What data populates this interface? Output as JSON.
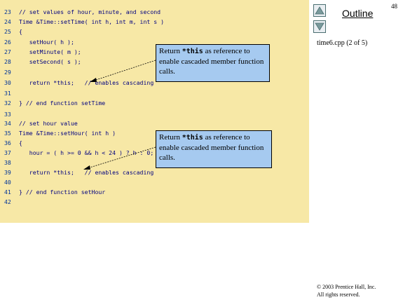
{
  "outline": {
    "title": "Outline",
    "page_number": "48",
    "file_label": "time6.cpp (2 of 5)"
  },
  "code_lines": [
    {
      "num": "23",
      "text": "// set values of hour, minute, and second"
    },
    {
      "num": "24",
      "text": "Time &Time::setTime( int h, int m, int s )"
    },
    {
      "num": "25",
      "text": "{"
    },
    {
      "num": "26",
      "text": "   setHour( h );"
    },
    {
      "num": "27",
      "text": "   setMinute( m );"
    },
    {
      "num": "28",
      "text": "   setSecond( s );"
    },
    {
      "num": "29",
      "text": ""
    },
    {
      "num": "30",
      "text": "   return *this;   // enables cascading"
    },
    {
      "num": "31",
      "text": ""
    },
    {
      "num": "32",
      "text": "} // end function setTime"
    },
    {
      "num": "33",
      "text": ""
    },
    {
      "num": "34",
      "text": "// set hour value"
    },
    {
      "num": "35",
      "text": "Time &Time::setHour( int h )"
    },
    {
      "num": "36",
      "text": "{"
    },
    {
      "num": "37",
      "text": "   hour = ( h >= 0 && h < 24 ) ? h : 0;"
    },
    {
      "num": "38",
      "text": ""
    },
    {
      "num": "39",
      "text": "   return *this;   // enables cascading"
    },
    {
      "num": "40",
      "text": ""
    },
    {
      "num": "41",
      "text": "} // end function setHour"
    },
    {
      "num": "42",
      "text": ""
    }
  ],
  "callouts": [
    {
      "prefix": "Return ",
      "code": "*this",
      "suffix": " as reference to enable cascaded member function calls."
    },
    {
      "prefix": "Return ",
      "code": "*this",
      "suffix": " as reference to enable cascaded member function calls."
    }
  ],
  "copyright": {
    "line1": "© 2003 Prentice Hall, Inc.",
    "line2": "All rights reserved."
  },
  "colors": {
    "code_background": "#f7e8a6",
    "callout_background": "#a6caf0",
    "line_number": "#003399",
    "code_text": "#000080"
  }
}
